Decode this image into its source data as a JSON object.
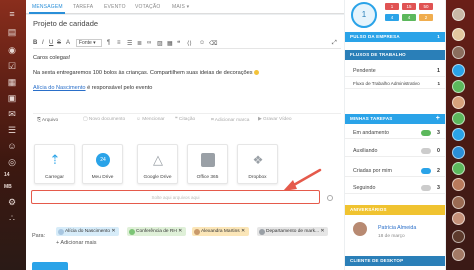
{
  "rail": {
    "label_top": "14",
    "label_mid": "MB"
  },
  "tabs": [
    {
      "label": "MENSAGEM"
    },
    {
      "label": "TAREFA"
    },
    {
      "label": "EVENTO"
    },
    {
      "label": "VOTAÇÃO"
    },
    {
      "label": "MAIS"
    }
  ],
  "editor": {
    "title": "Projeto de caridade",
    "font_value": "Fonte",
    "line1": "Caros colegas!",
    "line2": "Na sexta entregaremos 100 bolos às crianças. Compartilhem suas ideias de decorações",
    "mention": "Alícia do Nascimento",
    "line3_rest": " é responsável pelo evento"
  },
  "attach_bar": {
    "items": [
      "Arquivo",
      "Novo documento",
      "Mencionar",
      "Citação",
      "Adicionar marca",
      "Gravar Vídeo"
    ]
  },
  "services": [
    {
      "label": "Carregar",
      "color": "#2aa3e8"
    },
    {
      "label": "Meu Drive",
      "color": "#2aa3e8"
    },
    {
      "label": "Google Drive",
      "color": "#9aa0a6"
    },
    {
      "label": "Office 365",
      "color": "#9aa0a6"
    },
    {
      "label": "Dropbox",
      "color": "#9aa0a6"
    }
  ],
  "drop_zone": {
    "text": "Solte aqui arquivos aqui"
  },
  "recipients": {
    "label": "Para:",
    "chips": [
      {
        "label": "Alícia do Nascimento",
        "bg": "#d7ecf9"
      },
      {
        "label": "Conferência de RH",
        "bg": "#dff0d8"
      },
      {
        "label": "Alexandra Martins",
        "bg": "#fbe6b8"
      },
      {
        "label": "Departamento de mark...",
        "bg": "#e6e6e6"
      }
    ],
    "add_label": "+ Adicionar mais"
  },
  "right": {
    "avatar_initial": "1",
    "counters": [
      {
        "value": "1",
        "color": "#e05353"
      },
      {
        "value": "15",
        "color": "#e05353"
      },
      {
        "value": "50",
        "color": "#e05353"
      },
      {
        "value": "4",
        "color": "#2aa3e8"
      },
      {
        "value": "4",
        "color": "#5cb85c"
      },
      {
        "value": "2",
        "color": "#f0ad4e"
      }
    ],
    "pulso": {
      "title": "PULSO DA EMPRESA",
      "value": "1"
    },
    "fluxos": {
      "title": "FLUXOS DE TRABALHO",
      "rows": [
        {
          "label": "Pendente",
          "value": "1"
        },
        {
          "label": "Fluxo de Trabalho Administrativo",
          "value": "1"
        }
      ]
    },
    "tarefas": {
      "title": "MINHAS TAREFAS",
      "rows": [
        {
          "label": "Em andamento",
          "value": "3",
          "pill": "#5cb85c"
        },
        {
          "label": "Auxiliando",
          "value": "0",
          "pill": "#9aa0a6"
        },
        {
          "label": "Criadas por mim",
          "value": "2",
          "pill": "#2aa3e8"
        },
        {
          "label": "Seguindo",
          "value": "3",
          "pill": "#9aa0a6"
        }
      ]
    },
    "aniversarios": {
      "title": "ANIVERSÁRIOS",
      "name": "Patrícia Almeida",
      "date": "18 de março"
    },
    "cliente": {
      "title": "CLIENTE DE DESKTOP"
    }
  }
}
